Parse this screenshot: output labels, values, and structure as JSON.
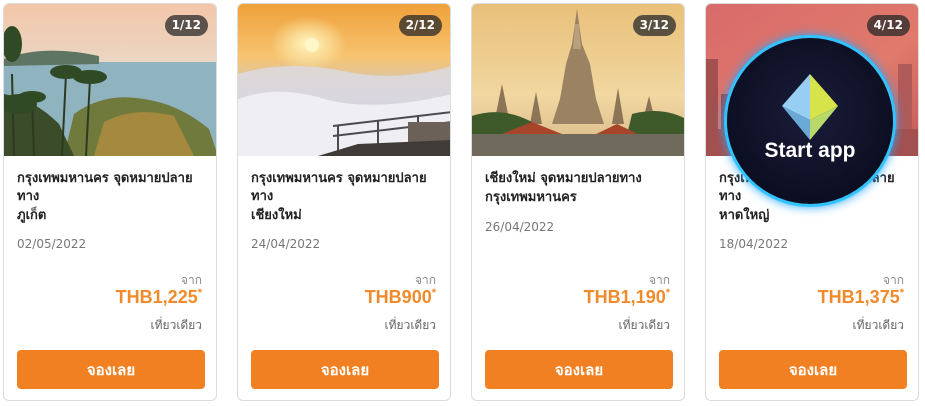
{
  "cards": [
    {
      "counter": "1/12",
      "origin": "กรุงเทพมหานคร จุดหมายปลายทาง",
      "destination": "ภูเก็ต",
      "date": "02/05/2022",
      "from_label": "จาก",
      "price": "THB1,225",
      "asterisk": "*",
      "trip_type": "เที่ยวเดียว",
      "book_label": "จองเลย"
    },
    {
      "counter": "2/12",
      "origin": "กรุงเทพมหานคร จุดหมายปลายทาง",
      "destination": "เชียงใหม่",
      "date": "24/04/2022",
      "from_label": "จาก",
      "price": "THB900",
      "asterisk": "*",
      "trip_type": "เที่ยวเดียว",
      "book_label": "จองเลย"
    },
    {
      "counter": "3/12",
      "origin": "เชียงใหม่ จุดหมายปลายทาง",
      "destination": "กรุงเทพมหานคร",
      "date": "26/04/2022",
      "from_label": "จาก",
      "price": "THB1,190",
      "asterisk": "*",
      "trip_type": "เที่ยวเดียว",
      "book_label": "จองเลย"
    },
    {
      "counter": "4/12",
      "origin": "กรุงเทพมหานคร จุดหมายปลายทาง",
      "destination": "หาดใหญ่",
      "date": "18/04/2022",
      "from_label": "จาก",
      "price": "THB1,375",
      "asterisk": "*",
      "trip_type": "เที่ยวเดียว",
      "book_label": "จองเลย"
    }
  ],
  "overlay": {
    "label": "Start app",
    "icon": "ethereum-diamond-icon"
  },
  "colors": {
    "accent": "#f08022",
    "price": "#f08a2a",
    "overlay_ring": "#2fc3ff"
  }
}
